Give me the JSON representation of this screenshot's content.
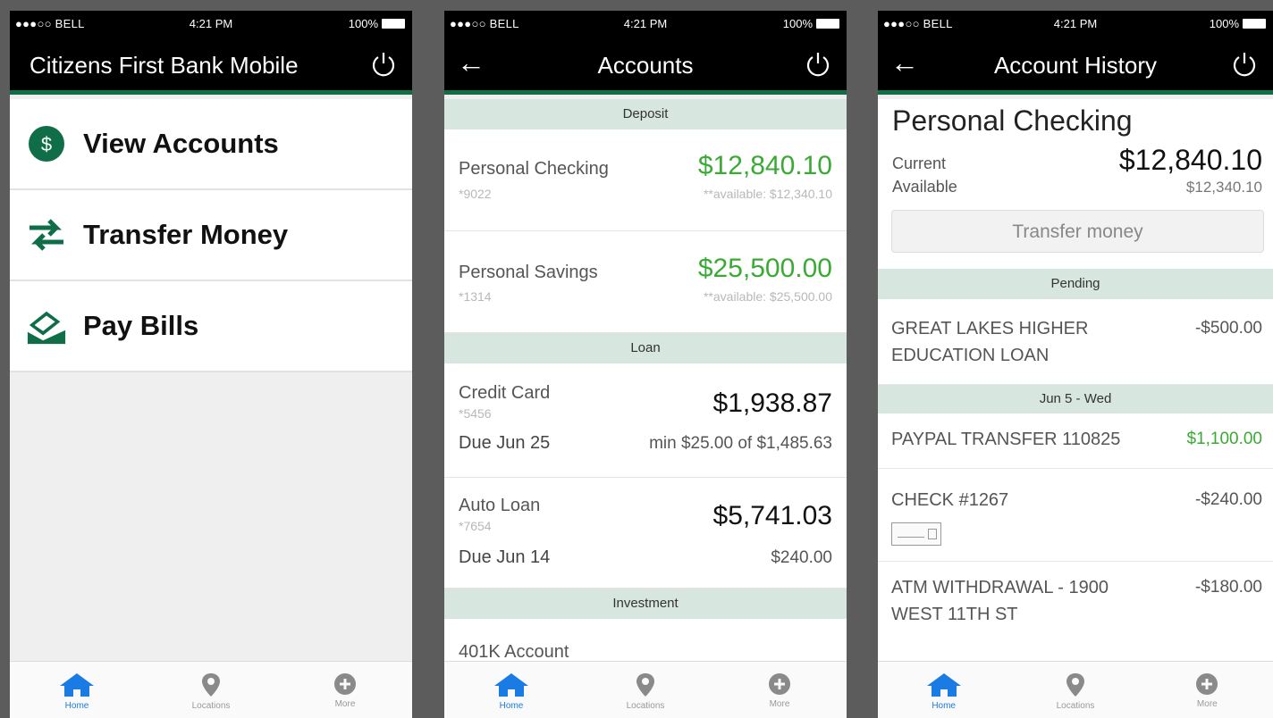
{
  "status": {
    "carrier": "●●●○○ BELL",
    "time": "4:21 PM",
    "battery": "100%"
  },
  "tabs": [
    {
      "label": "Home",
      "icon": "home-icon"
    },
    {
      "label": "Locations",
      "icon": "map-pin-icon"
    },
    {
      "label": "More",
      "icon": "plus-circle-icon"
    }
  ],
  "colors": {
    "brand_green": "#0f6e48",
    "amount_green": "#3aaa35",
    "tab_active": "#1a7be5"
  },
  "home": {
    "title": "Citizens First Bank Mobile",
    "menu": [
      {
        "label": "View Accounts",
        "icon": "dollar-circle-icon"
      },
      {
        "label": "Transfer Money",
        "icon": "transfer-arrows-icon"
      },
      {
        "label": "Pay Bills",
        "icon": "pay-bills-icon"
      }
    ]
  },
  "accounts": {
    "title": "Accounts",
    "sections": {
      "deposit": "Deposit",
      "loan": "Loan",
      "investment": "Investment"
    },
    "checking": {
      "name": "Personal Checking",
      "num": "*9022",
      "amount": "$12,840.10",
      "avail": "**available: $12,340.10"
    },
    "savings": {
      "name": "Personal Savings",
      "num": "*1314",
      "amount": "$25,500.00",
      "avail": "**available: $25,500.00"
    },
    "credit": {
      "name": "Credit Card",
      "num": "*5456",
      "amount": "$1,938.87",
      "due": "Due Jun 25",
      "min": "min $25.00 of $1,485.63"
    },
    "auto": {
      "name": "Auto Loan",
      "num": "*7654",
      "amount": "$5,741.03",
      "due": "Due Jun 14",
      "min": "$240.00"
    },
    "k401": {
      "name": "401K Account"
    }
  },
  "history": {
    "title": "Account History",
    "account_name": "Personal Checking",
    "current_label": "Current",
    "current_value": "$12,840.10",
    "available_label": "Available",
    "available_value": "$12,340.10",
    "transfer_button": "Transfer money",
    "pending_header": "Pending",
    "date_header": "Jun 5 - Wed",
    "pending": [
      {
        "desc": "GREAT LAKES HIGHER EDUCATION LOAN",
        "amount": "-$500.00"
      }
    ],
    "transactions": [
      {
        "desc": "PAYPAL TRANSFER 110825",
        "amount": "$1,100.00"
      },
      {
        "desc": "CHECK #1267",
        "amount": "-$240.00"
      },
      {
        "desc": "ATM WITHDRAWAL - 1900 WEST 11TH ST",
        "amount": "-$180.00"
      }
    ]
  }
}
